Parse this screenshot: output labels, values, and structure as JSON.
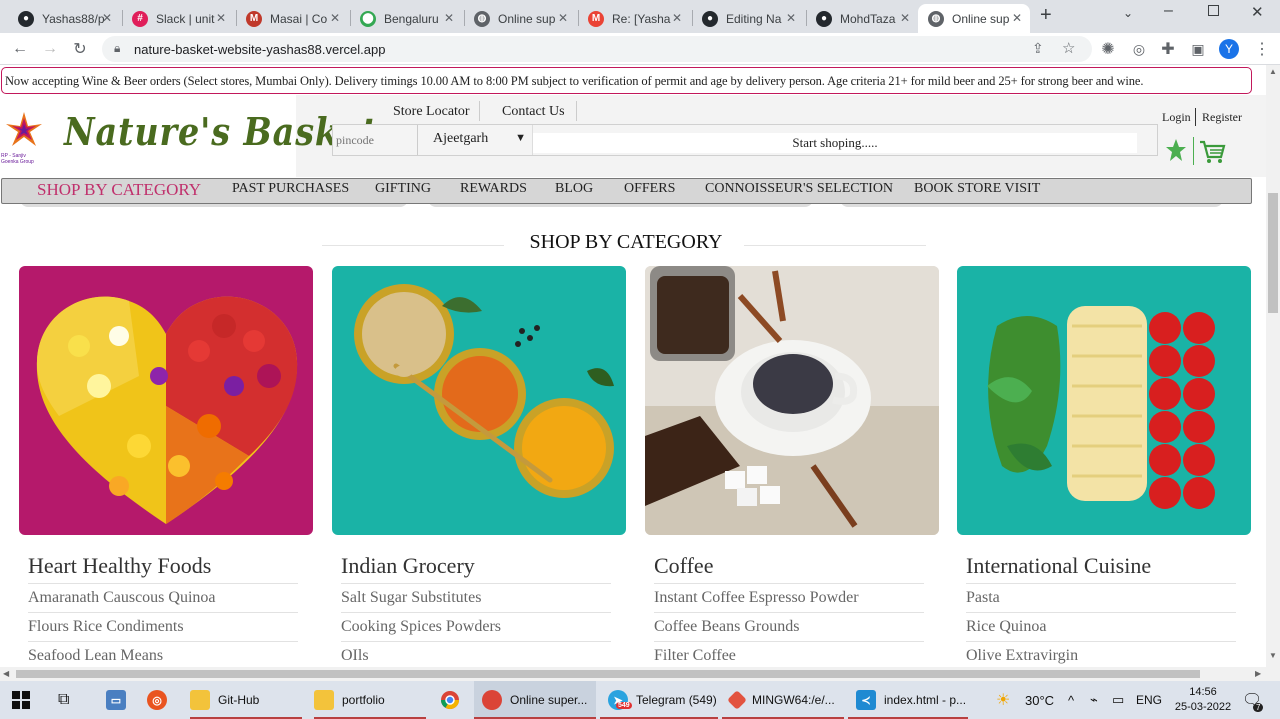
{
  "browser": {
    "tabs": [
      {
        "title": "Yashas88/p",
        "icon": "github-icon",
        "color": "#24292e"
      },
      {
        "title": "Slack | unit",
        "icon": "slack-icon",
        "color": "#e01e5a"
      },
      {
        "title": "Masai | Co",
        "icon": "masai-icon",
        "color": "#c0392b"
      },
      {
        "title": "Bengaluru",
        "icon": "maps-icon",
        "color": "#34a853"
      },
      {
        "title": "Online sup",
        "icon": "globe-icon",
        "color": "#5f6368"
      },
      {
        "title": "Re: [Yasha",
        "icon": "gmail-icon",
        "color": "#ea4335"
      },
      {
        "title": "Editing Na",
        "icon": "github-icon",
        "color": "#24292e"
      },
      {
        "title": "MohdTaza",
        "icon": "github-icon",
        "color": "#24292e"
      },
      {
        "title": "Online sup",
        "icon": "globe-icon",
        "color": "#5f6368"
      }
    ],
    "active_tab": 8,
    "url": "nature-basket-website-yashas88.vercel.app",
    "profile_initial": "Y"
  },
  "site": {
    "announcement": "Now accepting Wine & Beer orders (Select stores, Mumbai Only). Delivery timings 10.00 AM to 8:00 PM subject to verification of permit and age by delivery person. Age criteria 21+ for mild beer and 25+ for strong beer and wine.",
    "logo_text": "Nature's Basket",
    "logo_sub": "RP - Sanjiv Goenka Group",
    "store_locator": "Store Locator",
    "contact_us": "Contact Us",
    "pincode_placeholder": "pincode",
    "city": "Ajeetgarh",
    "search_placeholder": "Start shoping.....",
    "login": "Login",
    "register": "Register",
    "nav": [
      "SHOP BY CATEGORY",
      "PAST PURCHASES",
      "GIFTING",
      "REWARDS",
      "BLOG",
      "OFFERS",
      "CONNOISSEUR'S SELECTION",
      "BOOK STORE VISIT"
    ],
    "section_title": "SHOP BY CATEGORY",
    "categories": [
      {
        "title": "Heart Healthy Foods",
        "items": [
          "Amaranath Causcous Quinoa",
          "Flours Rice Condiments",
          "Seafood Lean Means"
        ],
        "bg": "#b5196b"
      },
      {
        "title": "Indian Grocery",
        "items": [
          "Salt Sugar Substitutes",
          "Cooking Spices Powders",
          "OIls"
        ],
        "bg": "#1ab3a6"
      },
      {
        "title": "Coffee",
        "items": [
          "Instant Coffee Espresso Powder",
          "Coffee Beans Grounds",
          "Filter Coffee"
        ],
        "bg": "#d9d4cc"
      },
      {
        "title": "International Cuisine",
        "items": [
          "Pasta",
          "Rice Quinoa",
          "Olive Extravirgin"
        ],
        "bg": "#1ab3a6"
      }
    ]
  },
  "taskbar": {
    "items": [
      "Git-Hub",
      "portfolio",
      "Online super...",
      "Telegram (549)",
      "MINGW64:/e/...",
      "index.html - p..."
    ],
    "telegram_badge": "549",
    "temperature": "30°C",
    "language": "ENG",
    "time": "14:56",
    "date": "25-03-2022",
    "notifications": "7"
  }
}
